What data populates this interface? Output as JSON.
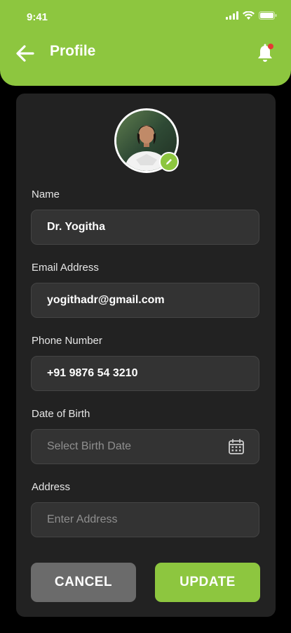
{
  "status_bar": {
    "time": "9:41"
  },
  "header": {
    "title": "Profile"
  },
  "form": {
    "name": {
      "label": "Name",
      "value": "Dr. Yogitha"
    },
    "email": {
      "label": "Email Address",
      "value": "yogithadr@gmail.com"
    },
    "phone": {
      "label": "Phone Number",
      "value": "+91 9876 54 3210"
    },
    "dob": {
      "label": "Date of Birth",
      "placeholder": "Select Birth Date"
    },
    "address": {
      "label": "Address",
      "placeholder": "Enter Address"
    }
  },
  "actions": {
    "cancel_label": "CANCEL",
    "update_label": "UPDATE"
  },
  "colors": {
    "accent": "#8dc63f",
    "card": "#222222",
    "field": "#333333",
    "notification_dot": "#e53935"
  }
}
